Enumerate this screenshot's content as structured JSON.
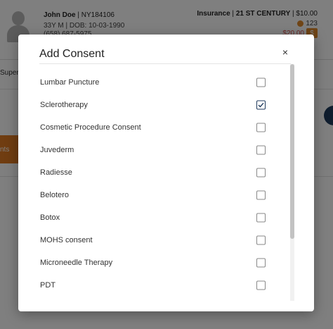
{
  "background": {
    "patient": {
      "name": "John Doe",
      "id": "NY184106",
      "demographics": "33Y M | DOB: 10-03-1990",
      "phone": "(658) 687-5975"
    },
    "insurance": {
      "label": "Insurance",
      "plan": "21 ST CENTURY",
      "amount": "$10.00",
      "points": "123",
      "balance": "$20.00",
      "dollar_symbol": "$"
    },
    "tab_partial": "Super",
    "orange_tab_partial": "nts"
  },
  "modal": {
    "title": "Add Consent",
    "close_symbol": "×",
    "items": [
      {
        "label": "Lumbar Puncture",
        "checked": false
      },
      {
        "label": "Sclerotherapy",
        "checked": true
      },
      {
        "label": "Cosmetic Procedure Consent",
        "checked": false
      },
      {
        "label": "Juvederm",
        "checked": false
      },
      {
        "label": "Radiesse",
        "checked": false
      },
      {
        "label": "Belotero",
        "checked": false
      },
      {
        "label": "Botox",
        "checked": false
      },
      {
        "label": "MOHS consent",
        "checked": false
      },
      {
        "label": "Microneedle Therapy",
        "checked": false
      },
      {
        "label": "PDT",
        "checked": false
      },
      {
        "label": "",
        "checked": false
      }
    ]
  },
  "colors": {
    "accent": "#1f3a5c",
    "orange": "#e07b22"
  }
}
